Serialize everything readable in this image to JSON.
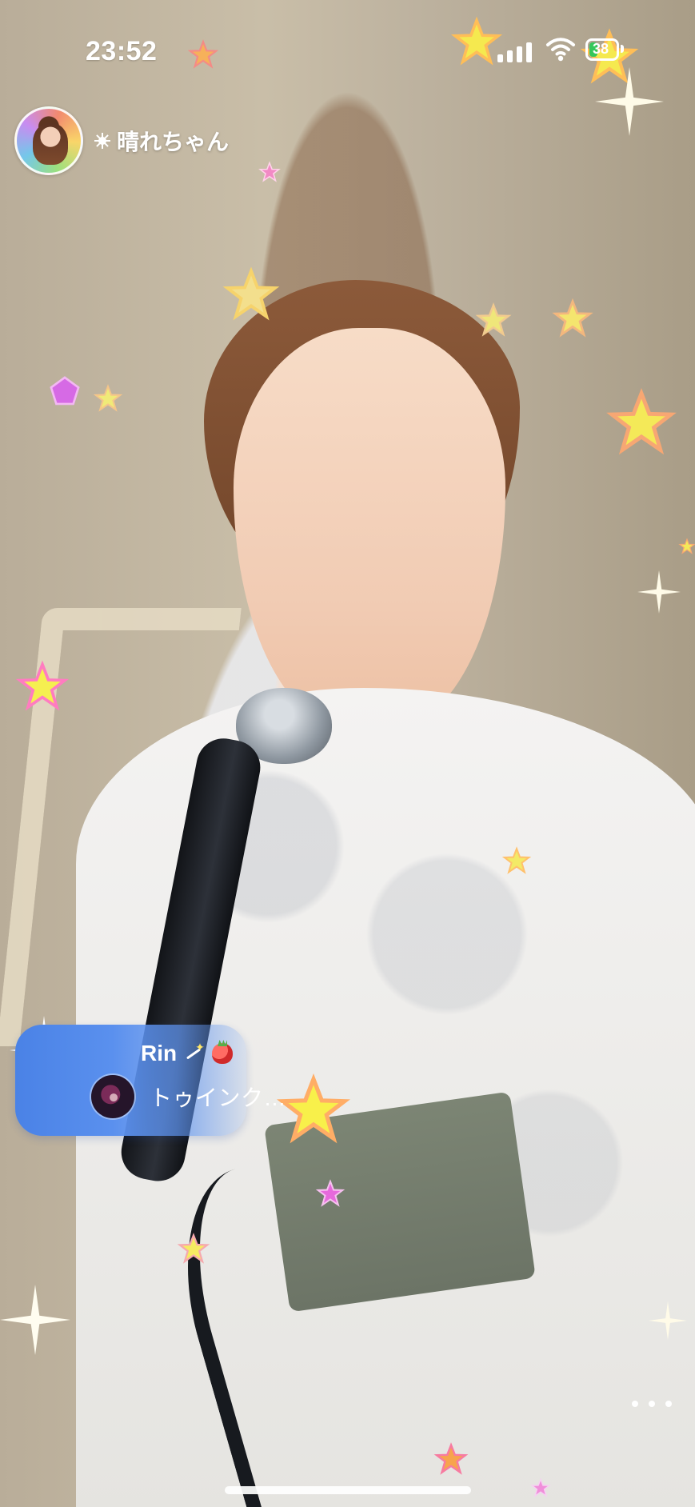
{
  "status_bar": {
    "time": "23:52",
    "battery_text": "38",
    "battery_level": 0.38
  },
  "host": {
    "name": "晴れちゃん"
  },
  "comment": {
    "user": "Rin",
    "text": "トゥインク…"
  },
  "colors": {
    "comment_background": "#5a90ee",
    "battery_green": "#35c759",
    "star_yellow": "#f5e94f",
    "star_pink": "#e05bd8"
  },
  "icons": {
    "status_signal": "cellular-signal-icon",
    "status_wifi": "wifi-icon",
    "status_battery": "battery-icon",
    "host_sun": "sun-icon",
    "comment_wand": "magic-wand-icon",
    "comment_strawberry": "strawberry-icon",
    "more": "more-options-icon"
  }
}
